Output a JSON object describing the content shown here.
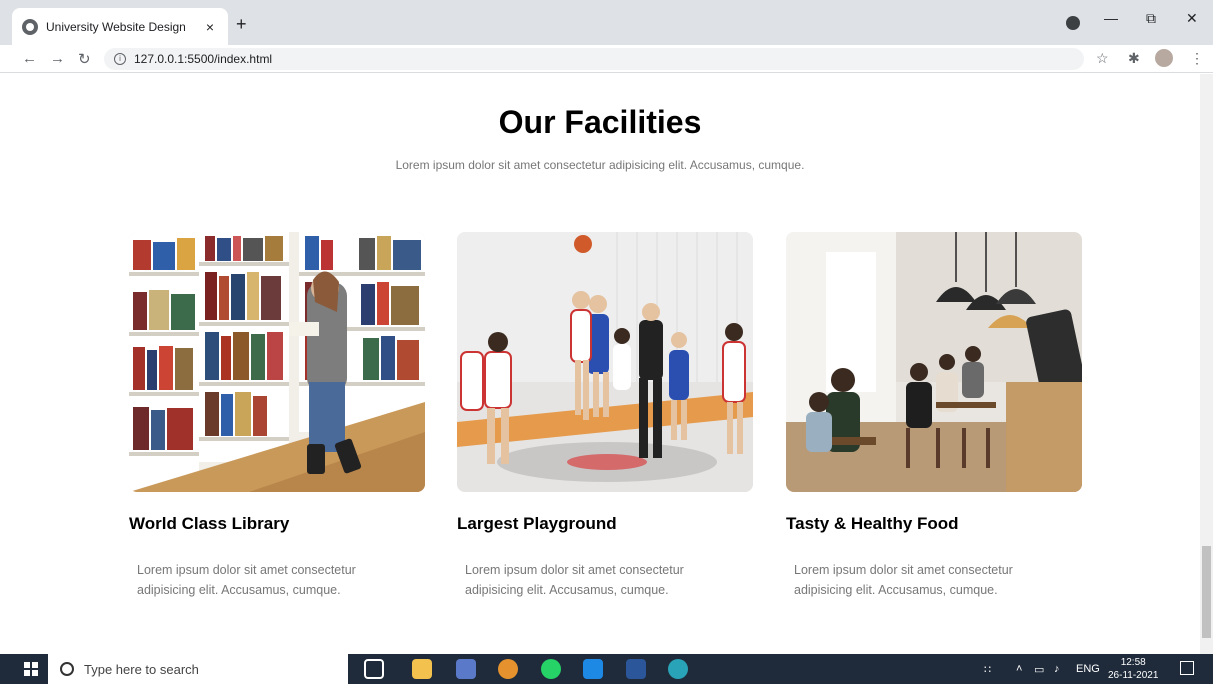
{
  "browser": {
    "tab_title": "University Website Design",
    "tab_close": "×",
    "new_tab": "+",
    "url": "127.0.0.1:5500/index.html"
  },
  "page": {
    "heading": "Our Facilities",
    "subtitle": "Lorem ipsum dolor sit amet consectetur adipisicing elit. Accusamus, cumque.",
    "cards": [
      {
        "title": "World Class Library",
        "description": "Lorem ipsum dolor sit amet consectetur adipisicing elit. Accusamus, cumque.",
        "image": "library-photo"
      },
      {
        "title": "Largest Playground",
        "description": "Lorem ipsum dolor sit amet consectetur adipisicing elit. Accusamus, cumque.",
        "image": "basketball-photo"
      },
      {
        "title": "Tasty & Healthy Food",
        "description": "Lorem ipsum dolor sit amet consectetur adipisicing elit. Accusamus, cumque.",
        "image": "cafeteria-photo"
      }
    ]
  },
  "taskbar": {
    "search_placeholder": "Type here to search",
    "language": "ENG",
    "time": "12:58",
    "date": "26-11-2021"
  }
}
